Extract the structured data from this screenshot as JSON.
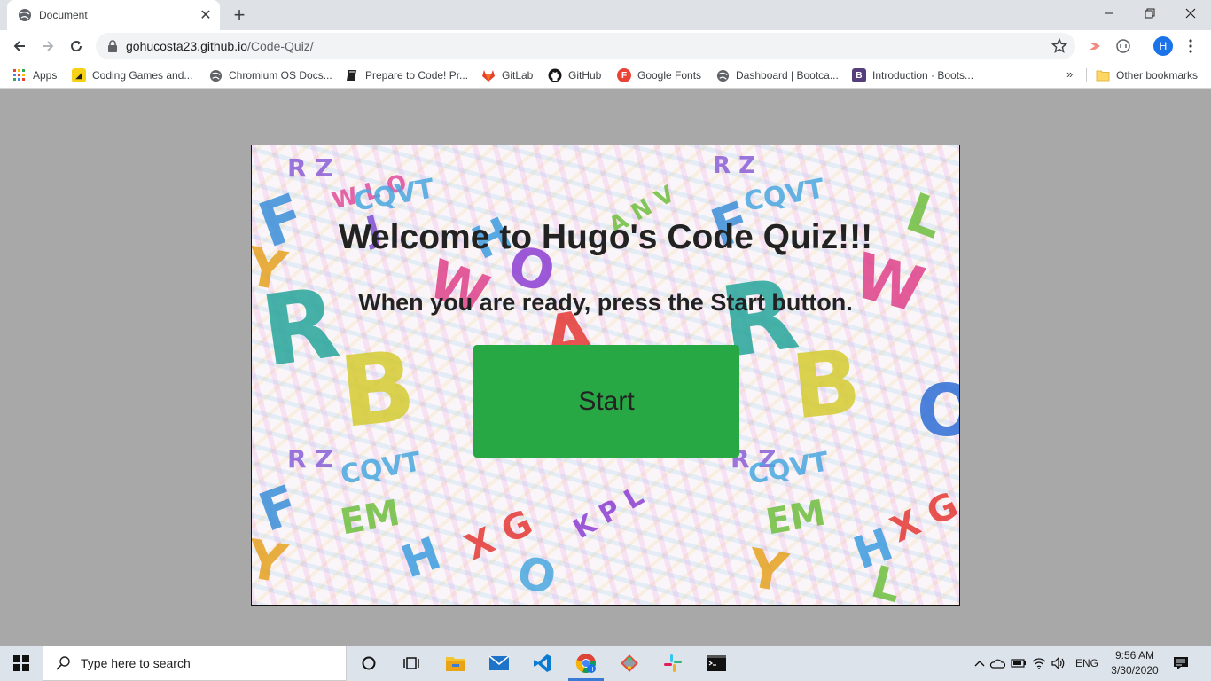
{
  "browser": {
    "tab_title": "Document",
    "url_host": "gohucosta23.github.io",
    "url_path": "/Code-Quiz/",
    "avatar_letter": "H"
  },
  "bookmarks": {
    "items": [
      {
        "label": "Apps",
        "icon": "apps-grid-icon"
      },
      {
        "label": "Coding Games and...",
        "icon": "coding-games-icon"
      },
      {
        "label": "Chromium OS Docs...",
        "icon": "globe-icon"
      },
      {
        "label": "Prepare to Code! Pr...",
        "icon": "book-icon"
      },
      {
        "label": "GitLab",
        "icon": "gitlab-icon"
      },
      {
        "label": "GitHub",
        "icon": "github-icon"
      },
      {
        "label": "Google Fonts",
        "icon": "google-fonts-icon"
      },
      {
        "label": "Dashboard | Bootca...",
        "icon": "globe-icon"
      },
      {
        "label": "Introduction · Boots...",
        "icon": "bootstrap-icon"
      }
    ],
    "more": "»",
    "other": "Other bookmarks"
  },
  "page": {
    "heading": "Welcome to Hugo's Code Quiz!!!",
    "subheading": "When you are ready, press the Start button.",
    "start_label": "Start"
  },
  "taskbar": {
    "search_placeholder": "Type here to search",
    "lang": "ENG",
    "time": "9:56 AM",
    "date": "3/30/2020"
  },
  "colors": {
    "start_button": "#28a745",
    "page_background": "#a8a8a8",
    "accent_blue": "#1a73e8"
  }
}
